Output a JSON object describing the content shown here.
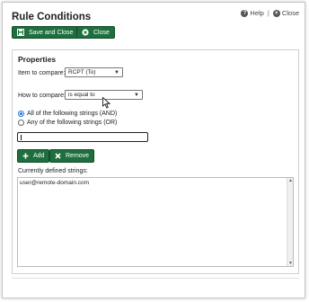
{
  "dialog": {
    "title": "Rule Conditions",
    "help_label": "Help",
    "close_link_label": "Close"
  },
  "toolbar": {
    "save_close_label": "Save and Close",
    "close_label": "Close"
  },
  "properties": {
    "section_title": "Properties",
    "item_label": "Item to compare:",
    "item_value": "RCPT (To)",
    "how_label": "How to compare:",
    "how_value": "is equal to",
    "radio_all_label": "All of the following strings (AND)",
    "radio_any_label": "Any of the following strings (OR)",
    "radio_selected": "all",
    "string_input_value": "",
    "add_label": "Add",
    "remove_label": "Remove",
    "defined_label": "Currently defined strings:",
    "defined_strings": [
      "user@remote-domain.com"
    ]
  },
  "colors": {
    "button_green": "#1e6f3f",
    "radio_selected": "#1a73e8"
  }
}
